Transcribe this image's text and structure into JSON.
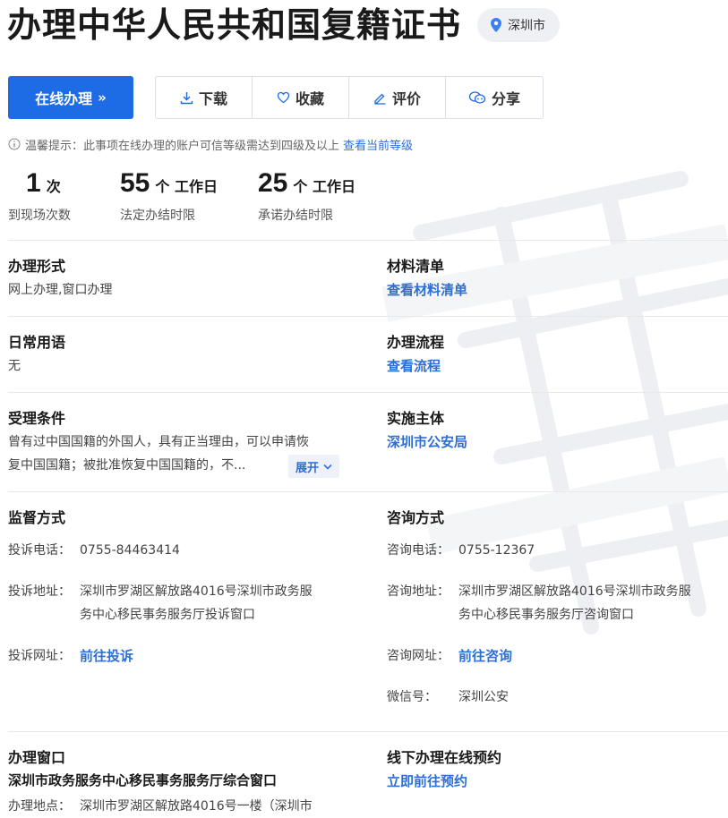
{
  "header": {
    "title": "办理中华人民共和国复籍证书",
    "city": "深圳市"
  },
  "actions": {
    "online": "在线办理",
    "online_chevron": "»",
    "download": "下载",
    "favorite": "收藏",
    "review": "评价",
    "share": "分享"
  },
  "tip": {
    "text": "温馨提示：此事项在线办理的账户可信等级需达到四级及以上",
    "link": "查看当前等级"
  },
  "stats": [
    {
      "num": "1",
      "unit": "次",
      "caption": "到现场次数"
    },
    {
      "num": "55",
      "unit": "个 工作日",
      "caption": "法定办结时限"
    },
    {
      "num": "25",
      "unit": "个 工作日",
      "caption": "承诺办结时限"
    }
  ],
  "sections": {
    "form": {
      "title": "办理形式",
      "value": "网上办理,窗口办理"
    },
    "materials": {
      "title": "材料清单",
      "link": "查看材料清单"
    },
    "phrases": {
      "title": "日常用语",
      "value": "无"
    },
    "process": {
      "title": "办理流程",
      "link": "查看流程"
    },
    "conditions": {
      "title": "受理条件",
      "text_line1": "曾有过中国国籍的外国人，具有正当理由，可以申请恢",
      "text_line2": "复中国国籍；被批准恢复中国国籍的，不...",
      "expand": "展开"
    },
    "authority": {
      "title": "实施主体",
      "link": "深圳市公安局"
    },
    "supervision": {
      "title": "监督方式",
      "phone_label": "投诉电话：",
      "phone": "0755-84463414",
      "address_label": "投诉地址：",
      "address_line1": "深圳市罗湖区解放路4016号深圳市政务服",
      "address_line2": "务中心移民事务服务厅投诉窗口",
      "web_label": "投诉网址：",
      "web_link": "前往投诉"
    },
    "consult": {
      "title": "咨询方式",
      "phone_label": "咨询电话：",
      "phone": "0755-12367",
      "address_label": "咨询地址：",
      "address_line1": "深圳市罗湖区解放路4016号深圳市政务服",
      "address_line2": "务中心移民事务服务厅咨询窗口",
      "web_label": "咨询网址：",
      "web_link": "前往咨询",
      "wechat_label": "微信号：",
      "wechat": "深圳公安"
    },
    "window": {
      "title": "办理窗口",
      "name": "深圳市政务服务中心移民事务服务厅综合窗口",
      "address_label": "办理地点：",
      "address": "深圳市罗湖区解放路4016号一楼（深圳市"
    },
    "booking": {
      "title": "线下办理在线预约",
      "link": "立即前往预约"
    }
  },
  "colors": {
    "primary": "#1e6be6",
    "link": "#2d6fd6",
    "badge_bg": "#eef0f4"
  }
}
